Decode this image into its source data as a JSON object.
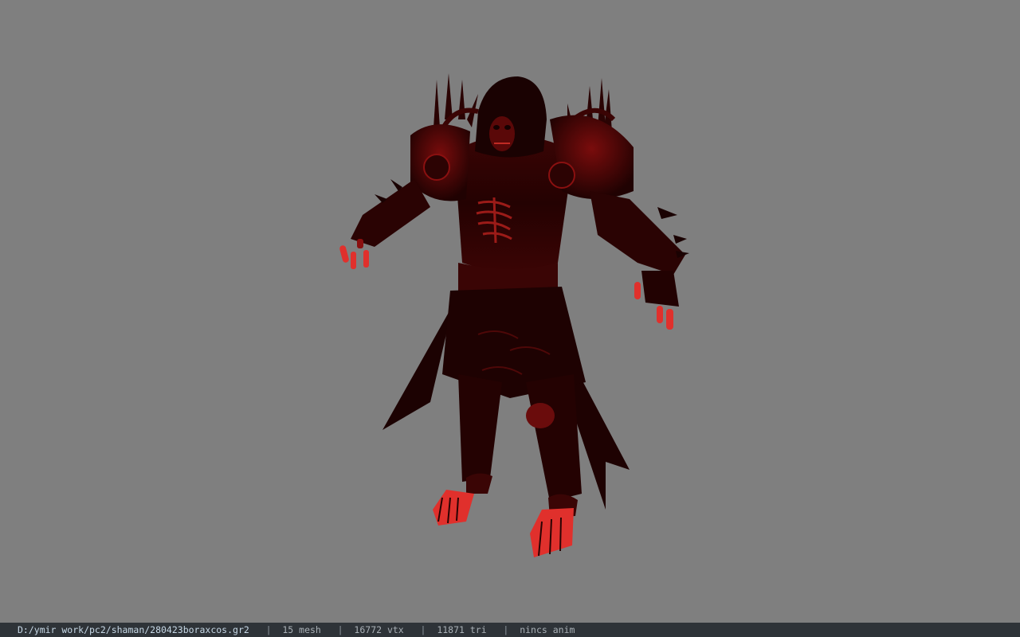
{
  "viewport": {
    "background_color": "#7f7f7f",
    "model_colors": {
      "dark": "#1a0202",
      "mid": "#5a0808",
      "highlight": "#e0302c",
      "glow": "#ff4a40"
    }
  },
  "statusbar": {
    "path": "D:/ymir work/pc2/shaman/280423boraxcos.gr2",
    "mesh": "15 mesh",
    "vtx": "16772 vtx",
    "tri": "11871 tri",
    "anim": "nincs anim",
    "separator": "|"
  }
}
